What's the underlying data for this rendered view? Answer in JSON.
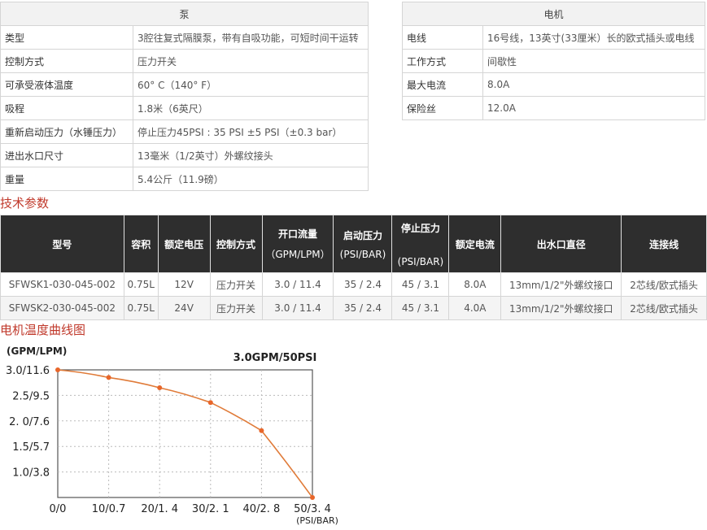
{
  "pump": {
    "header": "泵",
    "rows": [
      {
        "key": "类型",
        "value": "3腔往复式隔膜泵，带有自吸功能，可短时间干运转"
      },
      {
        "key": "控制方式",
        "value": "压力开关"
      },
      {
        "key": "可承受液体温度",
        "value": "60° C（140° F）"
      },
      {
        "key": "吸程",
        "value": "1.8米（6英尺）"
      },
      {
        "key": "重新启动压力（水锤压力）",
        "value": "停止压力45PSI : 35 PSI ±5 PSI（±0.3 bar）"
      },
      {
        "key": "进出水口尺寸",
        "value": "13毫米（1/2英寸）外螺纹接头"
      },
      {
        "key": "重量",
        "value": "5.4公斤（11.9磅）"
      }
    ]
  },
  "motor": {
    "header": "电机",
    "rows": [
      {
        "key": "电线",
        "value": "16号线，13英寸(33厘米）长的欧式插头或电线"
      },
      {
        "key": "工作方式",
        "value": "间歇性"
      },
      {
        "key": "最大电流",
        "value": "8.0A"
      },
      {
        "key": "保险丝",
        "value": "12.0A"
      }
    ]
  },
  "tech_title": "技术参数",
  "tech": {
    "headers": {
      "model": "型号",
      "volume": "容积",
      "rated_voltage": "额定电压",
      "control": "控制方式",
      "open_flow": "开口流量",
      "open_flow_unit": "（GPM/LPM）",
      "start_pressure": "启动压力",
      "start_pressure_unit": "(PSI/BAR)",
      "stop_pressure": "停止压力",
      "stop_pressure_unit": "(PSI/BAR)",
      "rated_current": "额定电流",
      "outlet": "出水口直径",
      "connector": "连接线"
    },
    "rows": [
      {
        "model": "SFWSK1-030-045-002",
        "volume": "0.75L",
        "voltage": "12V",
        "control": "压力开关",
        "flow": "3.0 / 11.4",
        "start": "35 / 2.4",
        "stop": "45 / 3.1",
        "current": "8.0A",
        "outlet": "13mm/1/2\"外螺纹接口",
        "connector": "2芯线/欧式插头"
      },
      {
        "model": "SFWSK2-030-045-002",
        "volume": "0.75L",
        "voltage": "24V",
        "control": "压力开关",
        "flow": "3.0 / 11.4",
        "start": "35 / 2.4",
        "stop": "45 / 3.1",
        "current": "4.0A",
        "outlet": "13mm/1/2\"外螺纹接口",
        "connector": "2芯线/欧式插头"
      }
    ]
  },
  "curve_title": "电机温度曲线图",
  "chart_data": {
    "type": "line",
    "title": "3.0GPM/50PSI",
    "ylabel": "(GPM/LPM)",
    "xlabel": "(PSI/BAR)",
    "x_ticks": [
      "0/0",
      "10/0.7",
      "20/1. 4",
      "30/2. 1",
      "40/2. 8",
      "50/3. 4"
    ],
    "y_ticks": [
      "3.0/11.6",
      "2.5/9.5",
      "2. 0/7.6",
      "1.5/5.7",
      "1.0/3.8"
    ],
    "x": [
      0,
      10,
      20,
      30,
      40,
      50
    ],
    "y": [
      3.0,
      2.85,
      2.65,
      2.36,
      1.81,
      0.5
    ],
    "xlim": [
      0,
      50
    ],
    "ylim": [
      0.5,
      3.0
    ],
    "grid": true,
    "line_color": "#e07b39",
    "point_color": "#e8662a"
  }
}
